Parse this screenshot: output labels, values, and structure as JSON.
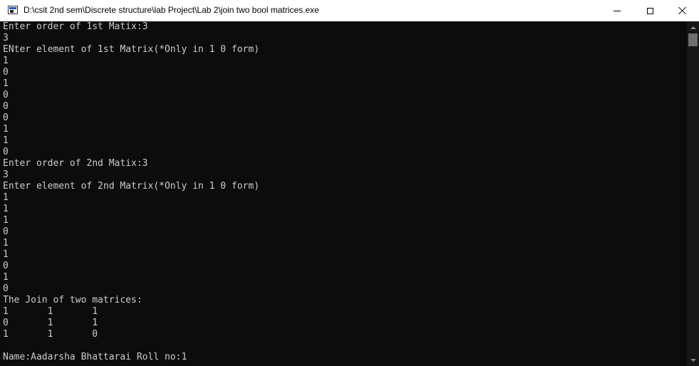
{
  "window": {
    "title": "D:\\csit 2nd sem\\Discrete structure\\lab Project\\Lab 2\\join two bool matrices.exe",
    "background": "#0c0c0c",
    "text_color": "#cccccc"
  },
  "icons": {
    "app": "console-app-icon",
    "minimize": "minimize-icon",
    "maximize": "maximize-icon",
    "close": "close-icon"
  },
  "console": {
    "lines": [
      "Enter order of 1st Matix:3",
      "3",
      "ENter element of 1st Matrix(*Only in 1 0 form)",
      "1",
      "0",
      "1",
      "0",
      "0",
      "0",
      "1",
      "1",
      "0",
      "Enter order of 2nd Matix:3",
      "3",
      "Enter element of 2nd Matrix(*Only in 1 0 form)",
      "1",
      "1",
      "1",
      "0",
      "1",
      "1",
      "0",
      "1",
      "0",
      "The Join of two matrices:",
      "1       1       1",
      "0       1       1",
      "1       1       0",
      "",
      "Name:Aadarsha Bhattarai Roll no:1"
    ]
  }
}
